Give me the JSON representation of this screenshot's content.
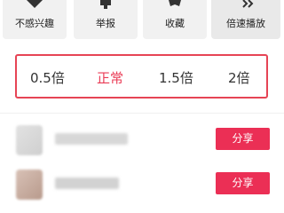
{
  "actions": [
    {
      "label": "不感兴趣",
      "icon": "dislike-icon"
    },
    {
      "label": "举报",
      "icon": "report-icon"
    },
    {
      "label": "收藏",
      "icon": "star-icon"
    },
    {
      "label": "倍速播放",
      "icon": "speed-icon"
    }
  ],
  "speed": {
    "options": [
      "0.5倍",
      "正常",
      "1.5倍",
      "2倍"
    ],
    "selected": "正常",
    "accent": "#ea3b55"
  },
  "share_rows": [
    {
      "button": "分享"
    },
    {
      "button": "分享"
    }
  ],
  "colors": {
    "accent": "#eb2f55",
    "border": "#e64455",
    "action_bg": "#f1f1f1"
  }
}
